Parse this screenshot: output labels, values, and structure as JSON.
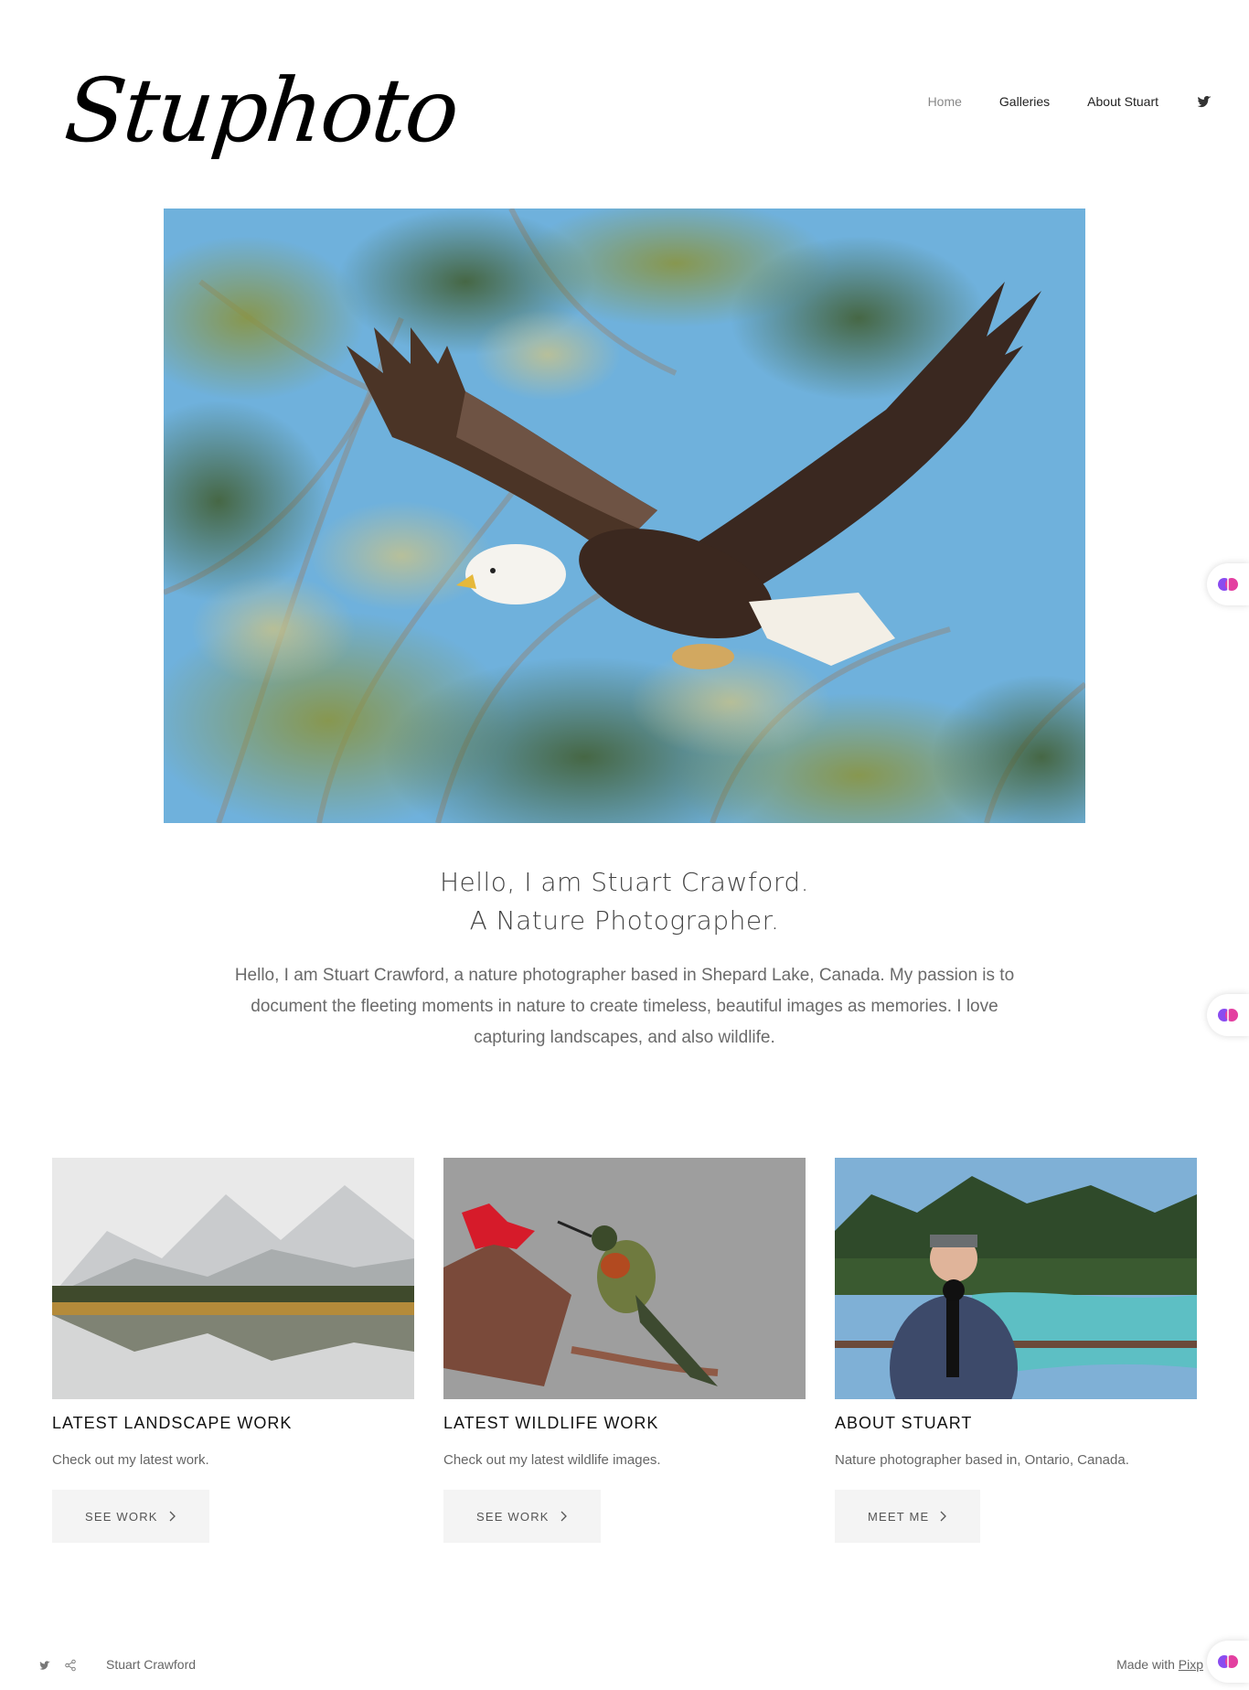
{
  "brand": {
    "name": "Stuphoto",
    "logo_icon": "camera-aperture-icon"
  },
  "nav": {
    "items": [
      {
        "label": "Home",
        "active": true
      },
      {
        "label": "Galleries",
        "active": false
      },
      {
        "label": "About Stuart",
        "active": false
      }
    ],
    "social_icon": "twitter-icon"
  },
  "hero": {
    "image_subject": "bald eagle in flight against blue sky"
  },
  "intro": {
    "title_line1": "Hello, I am Stuart Crawford.",
    "title_line2": "A Nature Photographer.",
    "body": "Hello, I am Stuart Crawford, a nature photographer based in Shepard Lake, Canada. My passion is to document the fleeting moments in nature to create timeless, beautiful images as memories. I love capturing landscapes, and also wildlife."
  },
  "cards": [
    {
      "title": "LATEST LANDSCAPE WORK",
      "text": "Check out my latest work.",
      "button": "SEE WORK"
    },
    {
      "title": "LATEST WILDLIFE WORK",
      "text": "Check out my latest wildlife images.",
      "button": "SEE WORK"
    },
    {
      "title": "ABOUT STUART",
      "text": "Nature photographer based in, Ontario, Canada.",
      "button": "MEET ME"
    }
  ],
  "footer": {
    "owner": "Stuart Crawford",
    "made_with_prefix": "Made with ",
    "made_with_link": "Pixp",
    "icons": [
      "twitter-icon",
      "share-icon"
    ]
  },
  "colors": {
    "sky": "#6fb1dc",
    "text_dark": "#111111",
    "button_bg": "#f4f4f4"
  }
}
